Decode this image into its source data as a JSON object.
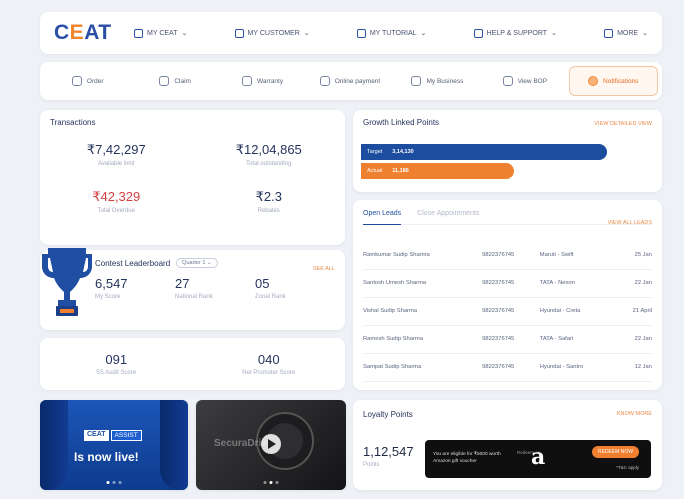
{
  "brand": {
    "logo_text": "CEAT"
  },
  "topnav": [
    {
      "label": "MY CEAT",
      "icon": "grid-icon"
    },
    {
      "label": "MY CUSTOMER",
      "icon": "user-icon"
    },
    {
      "label": "MY TUTORIAL",
      "icon": "book-icon"
    },
    {
      "label": "HELP & SUPPORT",
      "icon": "headset-icon"
    },
    {
      "label": "MORE",
      "icon": "more-icon"
    }
  ],
  "subnav": [
    {
      "label": "Order",
      "icon": "cart-icon"
    },
    {
      "label": "Claim",
      "icon": "claim-icon"
    },
    {
      "label": "Warranty",
      "icon": "shield-icon"
    },
    {
      "label": "Online payment",
      "icon": "card-icon"
    },
    {
      "label": "My Business",
      "icon": "briefcase-icon"
    },
    {
      "label": "View BOP",
      "icon": "eye-icon"
    },
    {
      "label": "Notifications",
      "icon": "bell-icon"
    }
  ],
  "transactions": {
    "title": "Transactions",
    "items": [
      {
        "value": "₹7,42,297",
        "label": "Available limit"
      },
      {
        "value": "₹12,04,865",
        "label": "Total outstanding"
      },
      {
        "value": "₹42,329",
        "label": "Total Overdue"
      },
      {
        "value": "₹2.3",
        "label": "Rebates"
      }
    ]
  },
  "contest": {
    "title": "Contest Leaderboard",
    "dropdown": "Quarter 1",
    "see_all": "SEE ALL",
    "stats": [
      {
        "value": "6,547",
        "label": "My Score"
      },
      {
        "value": "27",
        "label": "National Rank"
      },
      {
        "value": "05",
        "label": "Zonal Rank"
      }
    ]
  },
  "scores": [
    {
      "value": "091",
      "label": "5S Audit Score"
    },
    {
      "value": "040",
      "label": "Net Promoter Score"
    }
  ],
  "banner_assist": {
    "brand": "CEAT",
    "tag": "ASSIST",
    "headline": "Is now live!"
  },
  "banner_video": {
    "watermark": "SecuraDrive"
  },
  "growth": {
    "title": "Growth Linked Points",
    "link": "VIEW DETAILED VIEW",
    "target_label": "Target",
    "target_value": "3,14,130",
    "actual_label": "Actual",
    "actual_value": "11,186",
    "target_fraction": 1.0,
    "actual_fraction": 0.62
  },
  "leads": {
    "tabs": [
      "Open Leads",
      "Close Appointments"
    ],
    "see_all": "VIEW ALL LEADS",
    "rows": [
      {
        "name": "Ramkumar Sudip Sharma",
        "phone": "9822376745",
        "vehicle": "Maruti - Swift",
        "date": "25 Jan"
      },
      {
        "name": "Santosh Umesh Sharma",
        "phone": "9822376745",
        "vehicle": "TATA - Nexon",
        "date": "22 Jan"
      },
      {
        "name": "Vishal Sudip Sharma",
        "phone": "9822376745",
        "vehicle": "Hyundai - Creta",
        "date": "21 April"
      },
      {
        "name": "Ramesh Sudip Sharma",
        "phone": "9822376745",
        "vehicle": "TATA - Safari",
        "date": "22 Jan"
      },
      {
        "name": "Sampat Sudip Sharma",
        "phone": "9822376745",
        "vehicle": "Hyundai - Santro",
        "date": "12 Jan"
      }
    ]
  },
  "loyalty": {
    "title": "Loyalty Points",
    "link": "KNOW MORE",
    "value": "1,12,547",
    "label": "Points",
    "ad_text": "You are eligible for ₹5000 worth Amazon gift voucher",
    "ad_pre": "Redeem on",
    "ad_brand": "a",
    "ad_button": "REDEEM NOW",
    "ad_sub": "*T&C apply"
  }
}
